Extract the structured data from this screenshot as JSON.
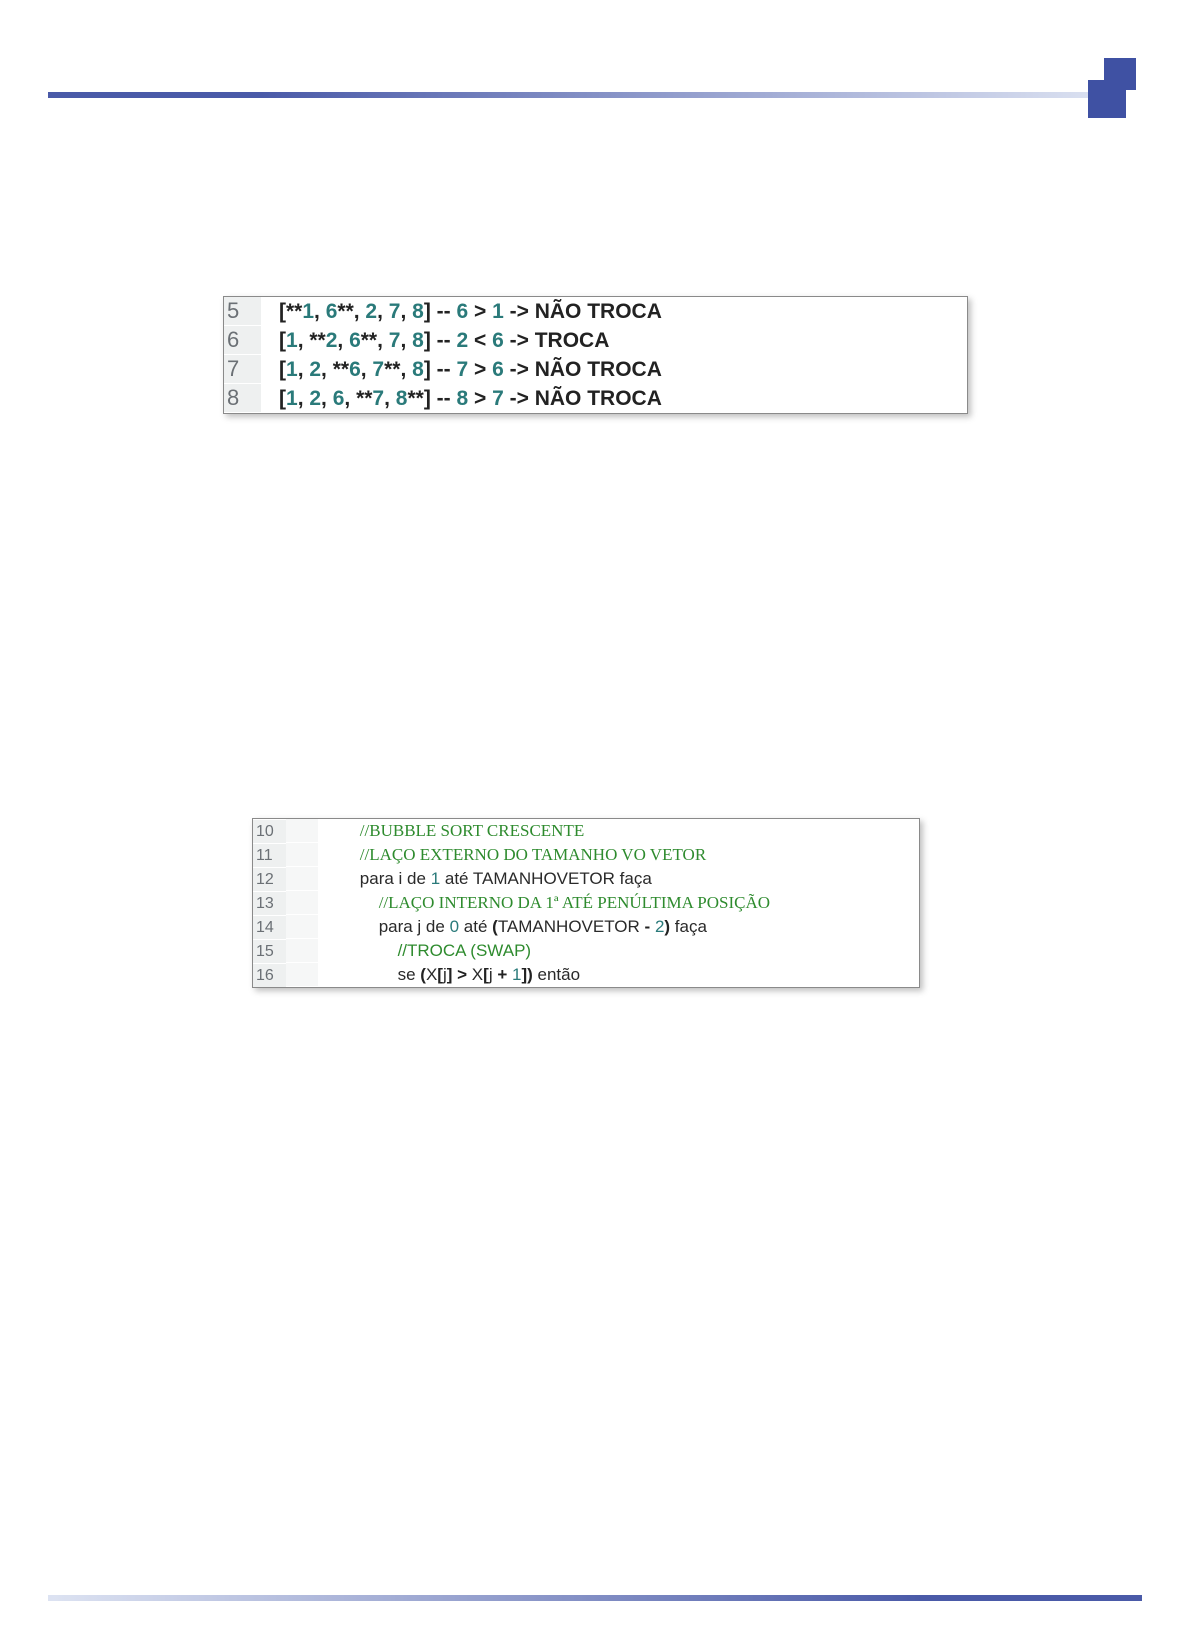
{
  "box1": {
    "lines": [
      {
        "num": "5",
        "tokens": [
          {
            "c": "p",
            "t": "[**"
          },
          {
            "c": "n",
            "t": "1"
          },
          {
            "c": "p",
            "t": ", "
          },
          {
            "c": "n",
            "t": "6"
          },
          {
            "c": "p",
            "t": "**, "
          },
          {
            "c": "n",
            "t": "2"
          },
          {
            "c": "p",
            "t": ", "
          },
          {
            "c": "n",
            "t": "7"
          },
          {
            "c": "p",
            "t": ", "
          },
          {
            "c": "n",
            "t": "8"
          },
          {
            "c": "p",
            "t": "]"
          },
          {
            "c": "op",
            "t": " -- "
          },
          {
            "c": "n",
            "t": "6"
          },
          {
            "c": "op",
            "t": " > "
          },
          {
            "c": "n",
            "t": "1"
          },
          {
            "c": "op",
            "t": " -> "
          },
          {
            "c": "tx",
            "t": "NÃO TROCA"
          }
        ]
      },
      {
        "num": "6",
        "tokens": [
          {
            "c": "p",
            "t": "["
          },
          {
            "c": "n",
            "t": "1"
          },
          {
            "c": "p",
            "t": ", **"
          },
          {
            "c": "n",
            "t": "2"
          },
          {
            "c": "p",
            "t": ", "
          },
          {
            "c": "n",
            "t": "6"
          },
          {
            "c": "p",
            "t": "**, "
          },
          {
            "c": "n",
            "t": "7"
          },
          {
            "c": "p",
            "t": ", "
          },
          {
            "c": "n",
            "t": "8"
          },
          {
            "c": "p",
            "t": "]"
          },
          {
            "c": "op",
            "t": " -- "
          },
          {
            "c": "n",
            "t": "2"
          },
          {
            "c": "op",
            "t": " < "
          },
          {
            "c": "n",
            "t": "6"
          },
          {
            "c": "op",
            "t": " -> "
          },
          {
            "c": "tx",
            "t": "TROCA"
          }
        ]
      },
      {
        "num": "7",
        "tokens": [
          {
            "c": "p",
            "t": "["
          },
          {
            "c": "n",
            "t": "1"
          },
          {
            "c": "p",
            "t": ", "
          },
          {
            "c": "n",
            "t": "2"
          },
          {
            "c": "p",
            "t": ", **"
          },
          {
            "c": "n",
            "t": "6"
          },
          {
            "c": "p",
            "t": ", "
          },
          {
            "c": "n",
            "t": "7"
          },
          {
            "c": "p",
            "t": "**, "
          },
          {
            "c": "n",
            "t": "8"
          },
          {
            "c": "p",
            "t": "]"
          },
          {
            "c": "op",
            "t": " -- "
          },
          {
            "c": "n",
            "t": "7"
          },
          {
            "c": "op",
            "t": " > "
          },
          {
            "c": "n",
            "t": "6"
          },
          {
            "c": "op",
            "t": " -> "
          },
          {
            "c": "tx",
            "t": "NÃO TROCA"
          }
        ]
      },
      {
        "num": "8",
        "tokens": [
          {
            "c": "p",
            "t": "["
          },
          {
            "c": "n",
            "t": "1"
          },
          {
            "c": "p",
            "t": ", "
          },
          {
            "c": "n",
            "t": "2"
          },
          {
            "c": "p",
            "t": ", "
          },
          {
            "c": "n",
            "t": "6"
          },
          {
            "c": "p",
            "t": ", **"
          },
          {
            "c": "n",
            "t": "7"
          },
          {
            "c": "p",
            "t": ", "
          },
          {
            "c": "n",
            "t": "8"
          },
          {
            "c": "p",
            "t": "**]"
          },
          {
            "c": "op",
            "t": " -- "
          },
          {
            "c": "n",
            "t": "8"
          },
          {
            "c": "op",
            "t": " > "
          },
          {
            "c": "n",
            "t": "7"
          },
          {
            "c": "op",
            "t": " -> "
          },
          {
            "c": "tx",
            "t": "NÃO TROCA"
          }
        ]
      }
    ]
  },
  "box2": {
    "lines": [
      {
        "num": "10",
        "indent": "        ",
        "tokens": [
          {
            "c": "cm",
            "t": "//BUBBLE SORT CRESCENTE"
          }
        ]
      },
      {
        "num": "11",
        "indent": "        ",
        "tokens": [
          {
            "c": "cm",
            "t": "//LAÇO EXTERNO DO TAMANHO VO VETOR"
          }
        ]
      },
      {
        "num": "12",
        "indent": "        ",
        "tokens": [
          {
            "c": "kw",
            "t": "para i de "
          },
          {
            "c": "nb",
            "t": "1"
          },
          {
            "c": "kw",
            "t": " até TAMANHOVETOR faça"
          }
        ]
      },
      {
        "num": "13",
        "indent": "            ",
        "tokens": [
          {
            "c": "cm",
            "t": "//LAÇO INTERNO DA 1ª ATÉ PENÚLTIMA POSIÇÃO"
          }
        ]
      },
      {
        "num": "14",
        "indent": "            ",
        "tokens": [
          {
            "c": "kw",
            "t": "para j de "
          },
          {
            "c": "nb",
            "t": "0"
          },
          {
            "c": "kw",
            "t": " até "
          },
          {
            "c": "pb",
            "t": "("
          },
          {
            "c": "kw",
            "t": "TAMANHOVETOR "
          },
          {
            "c": "pb",
            "t": "-"
          },
          {
            "c": "kw",
            "t": " "
          },
          {
            "c": "nb",
            "t": "2"
          },
          {
            "c": "pb",
            "t": ")"
          },
          {
            "c": "kw",
            "t": " faça"
          }
        ]
      },
      {
        "num": "15",
        "indent": "                ",
        "tokens": [
          {
            "c": "cm2",
            "t": "//TROCA (SWAP)"
          }
        ]
      },
      {
        "num": "16",
        "indent": "                ",
        "tokens": [
          {
            "c": "kw",
            "t": "se "
          },
          {
            "c": "pb",
            "t": "("
          },
          {
            "c": "kw",
            "t": "X"
          },
          {
            "c": "pb",
            "t": "["
          },
          {
            "c": "kw",
            "t": "j"
          },
          {
            "c": "pb",
            "t": "]"
          },
          {
            "c": "kw",
            "t": " "
          },
          {
            "c": "pb",
            "t": ">"
          },
          {
            "c": "kw",
            "t": " X"
          },
          {
            "c": "pb",
            "t": "["
          },
          {
            "c": "kw",
            "t": "j "
          },
          {
            "c": "pb",
            "t": "+"
          },
          {
            "c": "kw",
            "t": " "
          },
          {
            "c": "nb",
            "t": "1"
          },
          {
            "c": "pb",
            "t": "])"
          },
          {
            "c": "kw",
            "t": " então"
          }
        ]
      }
    ]
  }
}
